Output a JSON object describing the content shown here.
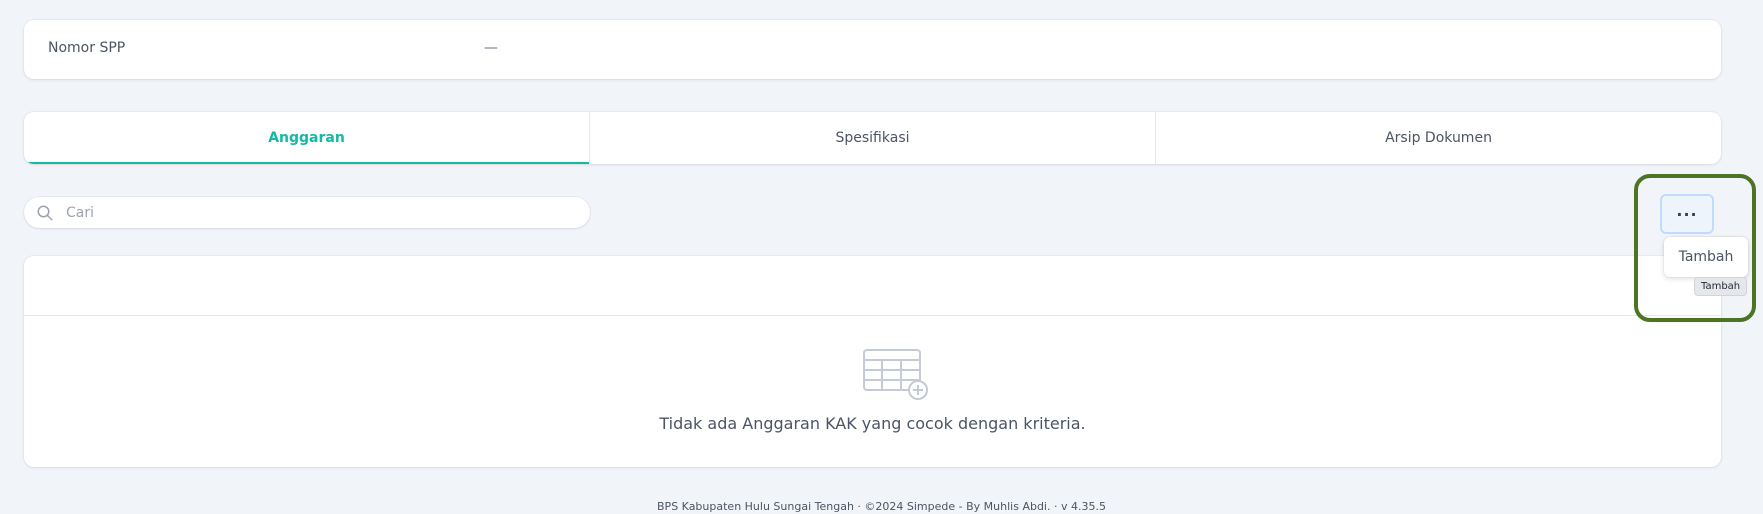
{
  "detail": {
    "label": "Nomor SPP",
    "value": "—"
  },
  "tabs": [
    {
      "label": "Anggaran",
      "active": true
    },
    {
      "label": "Spesifikasi",
      "active": false
    },
    {
      "label": "Arsip Dokumen",
      "active": false
    }
  ],
  "search": {
    "placeholder": "Cari",
    "value": ""
  },
  "actions": {
    "more_label": "···",
    "menu_item": "Tambah",
    "tooltip": "Tambah"
  },
  "table": {
    "empty_message": "Tidak ada Anggaran KAK yang cocok dengan kriteria."
  },
  "footer": {
    "text": "BPS Kabupaten Hulu Sungai Tengah  ·  ©2024 Simpede - By Muhlis Abdi.  ·  v 4.35.5"
  },
  "colors": {
    "accent": "#14b8a6",
    "highlight": "#4d7325",
    "background": "#f1f4f9"
  },
  "icons": {
    "search": "search-icon",
    "empty_table": "table-add-icon"
  }
}
